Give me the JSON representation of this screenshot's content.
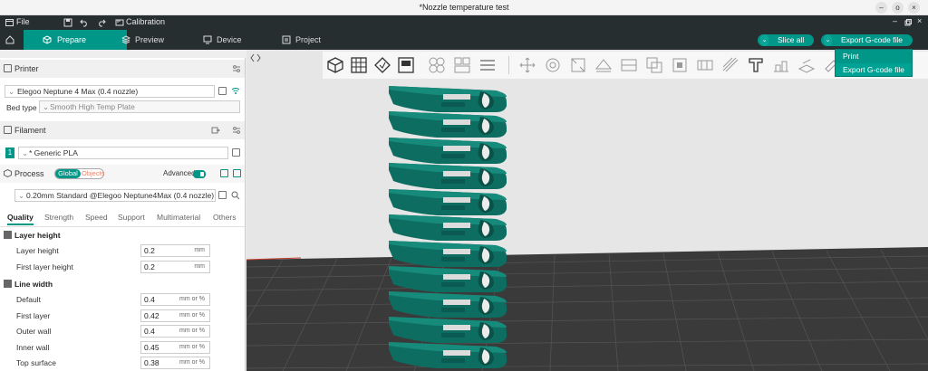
{
  "window": {
    "title": "*Nozzle temperature test",
    "controls": [
      "–",
      "o",
      "×"
    ]
  },
  "menubar": {
    "file_label": "File",
    "calibration_label": "Calibration"
  },
  "tabs": [
    {
      "label": "Prepare",
      "icon": "cube-icon",
      "active": true
    },
    {
      "label": "Preview",
      "icon": "layers-icon",
      "active": false
    },
    {
      "label": "Device",
      "icon": "monitor-icon",
      "active": false
    },
    {
      "label": "Project",
      "icon": "project-icon",
      "active": false
    }
  ],
  "actions": {
    "slice_label": "Slice all",
    "export_label": "Export G-code file"
  },
  "export_menu": {
    "items": [
      "Print",
      "Export G-code file"
    ],
    "highlighted": 1
  },
  "printer": {
    "section_label": "Printer",
    "name": "Elegoo Neptune 4 Max (0.4 nozzle)",
    "bed_type_label": "Bed type",
    "bed_type_value": "Smooth High Temp Plate"
  },
  "filament": {
    "section_label": "Filament",
    "index": "1",
    "name": "* Generic PLA"
  },
  "process": {
    "section_label": "Process",
    "global_label": "Global",
    "objects_label": "Objects",
    "advanced_label": "Advanced",
    "preset": "0.20mm Standard @Elegoo Neptune4Max (0.4 nozzle)"
  },
  "subtabs": [
    "Quality",
    "Strength",
    "Speed",
    "Support",
    "Multimaterial",
    "Others"
  ],
  "layer_height": {
    "title": "Layer height",
    "rows": [
      {
        "label": "Layer height",
        "value": "0.2",
        "unit": "mm"
      },
      {
        "label": "First layer height",
        "value": "0.2",
        "unit": "mm"
      }
    ]
  },
  "line_width": {
    "title": "Line width",
    "rows": [
      {
        "label": "Default",
        "value": "0.4",
        "unit": "mm or %"
      },
      {
        "label": "First layer",
        "value": "0.42",
        "unit": "mm or %"
      },
      {
        "label": "Outer wall",
        "value": "0.4",
        "unit": "mm or %"
      },
      {
        "label": "Inner wall",
        "value": "0.45",
        "unit": "mm or %"
      },
      {
        "label": "Top surface",
        "value": "0.38",
        "unit": "mm or %"
      }
    ]
  },
  "colors": {
    "accent": "#009688",
    "dark_bar": "#262e30",
    "model": "#0f6e62"
  }
}
